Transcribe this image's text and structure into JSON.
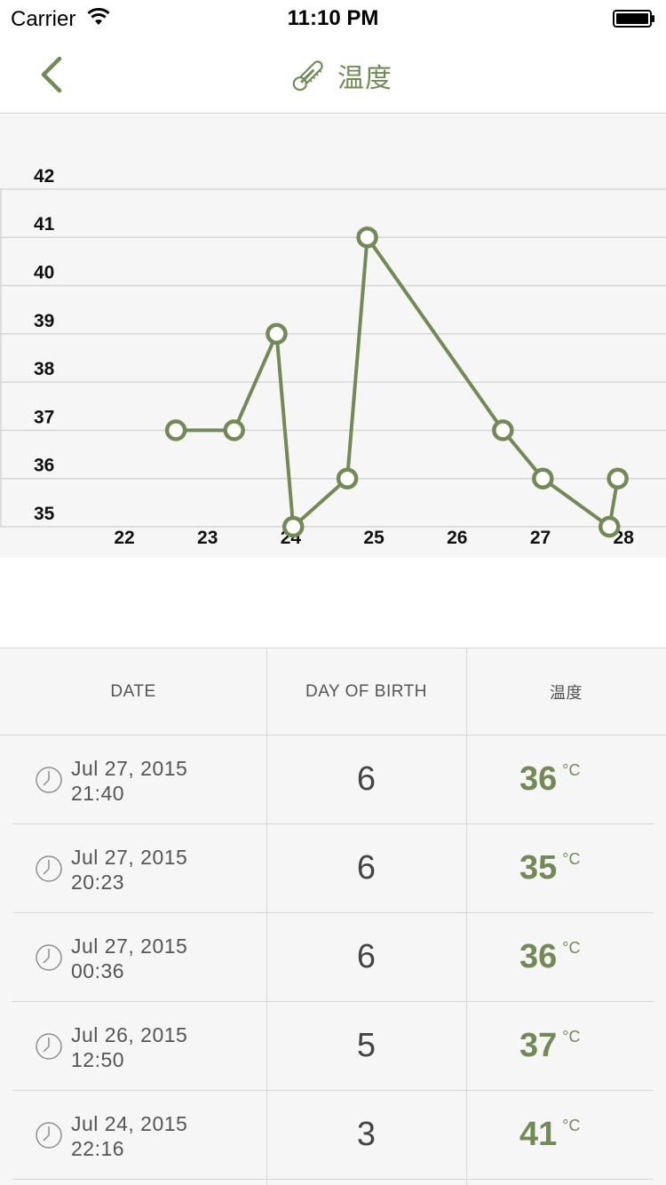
{
  "status": {
    "carrier": "Carrier",
    "time": "11:10 PM"
  },
  "nav": {
    "title": "温度",
    "back_icon": "chevron-left-icon",
    "title_icon": "thermometer-icon"
  },
  "colors": {
    "accent": "#728a54",
    "grid": "#d6d6d6",
    "background": "#f7f6f7"
  },
  "chart_data": {
    "type": "line",
    "title": "",
    "xlabel": "",
    "ylabel": "",
    "x_ticks": [
      "22",
      "23",
      "24",
      "25",
      "26",
      "27",
      "28"
    ],
    "y_ticks": [
      "35",
      "36",
      "37",
      "38",
      "39",
      "40",
      "41",
      "42"
    ],
    "xlim": [
      22,
      28
    ],
    "ylim": [
      35,
      42
    ],
    "grid": true,
    "series": [
      {
        "points": [
          {
            "x": 22.62,
            "y": 37
          },
          {
            "x": 23.32,
            "y": 37
          },
          {
            "x": 23.83,
            "y": 39
          },
          {
            "x": 24.03,
            "y": 35
          },
          {
            "x": 24.68,
            "y": 36
          },
          {
            "x": 24.92,
            "y": 41
          },
          {
            "x": 26.55,
            "y": 37
          },
          {
            "x": 27.03,
            "y": 36
          },
          {
            "x": 27.83,
            "y": 35
          },
          {
            "x": 27.93,
            "y": 36
          }
        ]
      }
    ]
  },
  "table": {
    "headers": {
      "date": "DATE",
      "day": "DAY OF BIRTH",
      "temp": "温度"
    },
    "unit": "°C",
    "rows": [
      {
        "date": "Jul 27, 2015",
        "time": "21:40",
        "day": "6",
        "temp": "36"
      },
      {
        "date": "Jul 27, 2015",
        "time": "20:23",
        "day": "6",
        "temp": "35"
      },
      {
        "date": "Jul 27, 2015",
        "time": "00:36",
        "day": "6",
        "temp": "36"
      },
      {
        "date": "Jul 26, 2015",
        "time": "12:50",
        "day": "5",
        "temp": "37"
      },
      {
        "date": "Jul 24, 2015",
        "time": "22:16",
        "day": "3",
        "temp": "41"
      }
    ]
  }
}
